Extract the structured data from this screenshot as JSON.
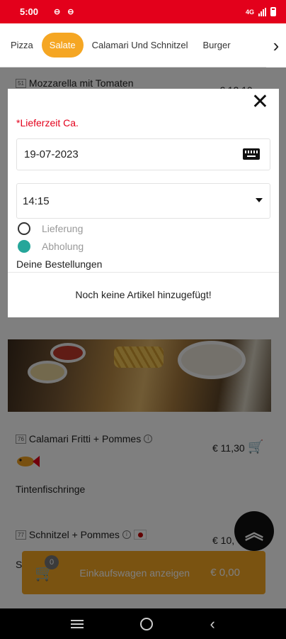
{
  "status_bar": {
    "time": "5:00",
    "network": "4G"
  },
  "tabs": {
    "items": [
      "Pizza",
      "Salate",
      "Calamari Und Schnitzel",
      "Burger"
    ],
    "active": "Salate",
    "next_icon": "chevron-right-icon"
  },
  "menu": {
    "item_top": {
      "number": "51",
      "name": "Mozzarella mit Tomaten",
      "price": "€ 12,10"
    },
    "item_calamari": {
      "number": "76",
      "name": "Calamari Fritti + Pommes",
      "price": "€ 11,30",
      "description": "Tintenfischringe"
    },
    "item_schnitzel": {
      "number": "77",
      "name": "Schnitzel + Pommes",
      "price": "€ 10,",
      "description_start": "S"
    }
  },
  "cart": {
    "count": "0",
    "label": "Einkaufswagen anzeigen",
    "total": "€ 0,00"
  },
  "modal": {
    "delivery_time_label": "*Lieferzeit Ca.",
    "date_value": "19-07-2023",
    "time_value": "14:15",
    "options": [
      {
        "label": "Lieferung",
        "checked": false
      },
      {
        "label": "Abholung",
        "checked": true
      }
    ],
    "orders_heading": "Deine Bestellungen",
    "empty_message": "Noch keine Artikel hinzugefügt!"
  },
  "colors": {
    "brand_red": "#e3001b",
    "accent_orange": "#f5a623",
    "radio_teal": "#26a69a"
  }
}
